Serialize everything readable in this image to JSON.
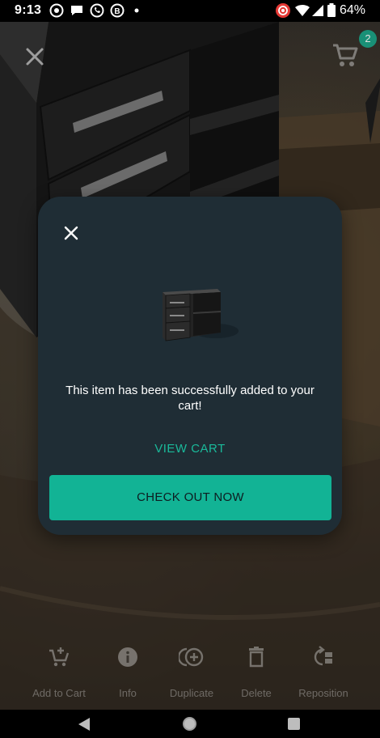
{
  "status_bar": {
    "time": "9:13",
    "battery": "64%"
  },
  "ar_view": {
    "close_icon": "close-icon",
    "cart_icon": "cart-icon",
    "cart_count": "2"
  },
  "modal": {
    "close_icon": "close-icon",
    "message": "This item has been successfully added to your cart!",
    "view_cart_label": "VIEW CART",
    "checkout_label": "CHECK OUT NOW"
  },
  "toolbar": {
    "items": [
      {
        "label": "Add to Cart",
        "icon": "add-to-cart-icon"
      },
      {
        "label": "Info",
        "icon": "info-icon"
      },
      {
        "label": "Duplicate",
        "icon": "duplicate-icon"
      },
      {
        "label": "Delete",
        "icon": "delete-icon"
      },
      {
        "label": "Reposition",
        "icon": "reposition-icon"
      }
    ]
  },
  "colors": {
    "modal_bg": "#1f2d35",
    "accent": "#12b395",
    "link": "#1ab99a"
  }
}
